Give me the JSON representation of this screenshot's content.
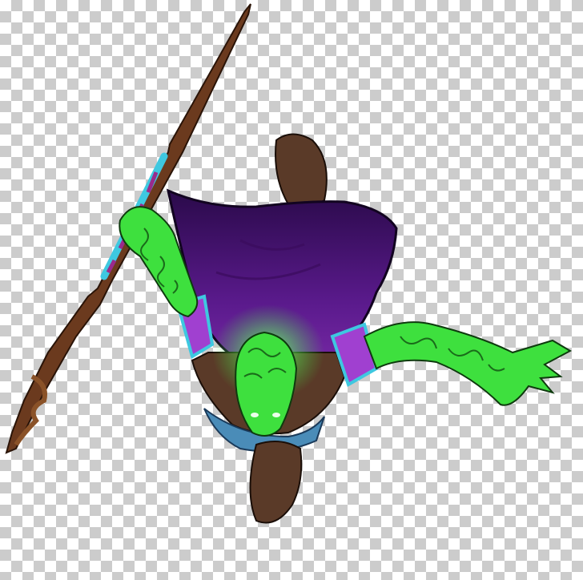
{
  "image": {
    "subject": "green-skinned-wizard-with-staff-top-down",
    "background": "transparency-checkerboard"
  },
  "colors": {
    "checker_light": "#ffffff",
    "checker_dark": "#cccccc",
    "skin": "#3ee03e",
    "skin_line": "#1a6b1a",
    "cloak": "#5a1a8c",
    "cloak_dark": "#2a0a4a",
    "staff": "#6b3a1e",
    "trim": "#3ec8e0",
    "boot": "#5a3a28"
  }
}
